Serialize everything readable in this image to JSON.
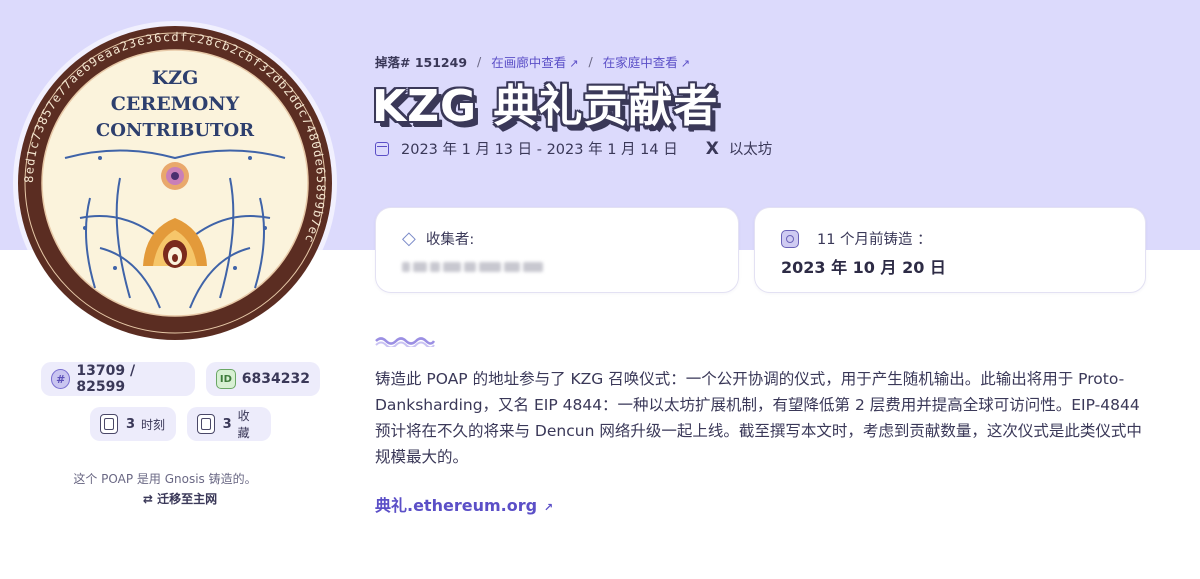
{
  "badge": {
    "title_lines": [
      "KZG",
      "CEREMONY",
      "CONTRIBUTOR"
    ],
    "ring_hex": "8ed1c73857e77ae69eaa23e36cdfc28cb2cbf32db2ddc7480de65899b7ec"
  },
  "stats": {
    "supply_icon": "#",
    "supply": "13709 / 82599",
    "id_icon": "ID",
    "id": "6834232",
    "moments_count": "3",
    "moments_label": "时刻",
    "collections_count": "3",
    "collections_label": "收藏"
  },
  "mint_note": "这个 POAP 是用 Gnosis 铸造的。",
  "migrate_label": "迁移至主网",
  "breadcrumb": {
    "drop": "掉落# 151249",
    "sep1": "/",
    "gallery_link": "在画廊中查看",
    "sep2": "/",
    "family_link": "在家庭中查看"
  },
  "title": "KZG 典礼贡献者",
  "dates": "2023 年 1 月 13 日 - 2023 年 1 月 14 日",
  "network": "以太坊",
  "collector": {
    "label": "收集者:"
  },
  "minted": {
    "label": "11 个月前铸造 ：",
    "date": "2023 年 10 月 20 日"
  },
  "description": "铸造此 POAP 的地址参与了 KZG 召唤仪式：一个公开协调的仪式，用于产生随机输出。此输出将用于 Proto-Danksharding，又名 EIP 4844：一种以太坊扩展机制，有望降低第 2 层费用并提高全球可访问性。EIP-4844 预计将在不久的将来与 Dencun 网络升级一起上线。截至撰写本文时，考虑到贡献数量，这次仪式是此类仪式中规模最大的。",
  "website": "典礼.ethereum.org",
  "colors": {
    "banner": "#dcdafc",
    "accent": "#5b4fc7",
    "badge_ring": "#5b2d22",
    "badge_bg": "#fbf3dc"
  }
}
